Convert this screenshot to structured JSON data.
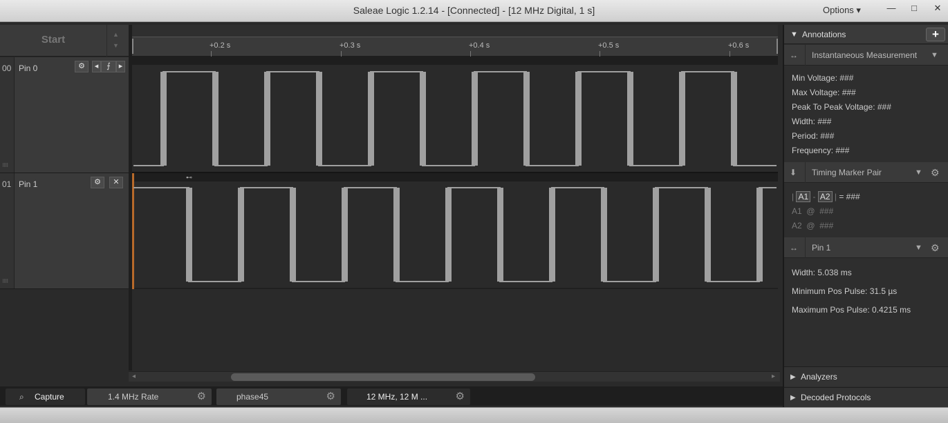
{
  "window": {
    "title": "Saleae Logic 1.2.14 - [Connected] - [12 MHz Digital, 1 s]",
    "options_label": "Options ▾",
    "minimize": "—",
    "maximize": "□",
    "close": "✕"
  },
  "controls": {
    "start_label": "Start"
  },
  "channels": [
    {
      "index": "00",
      "name": "Pin 0"
    },
    {
      "index": "01",
      "name": "Pin 1"
    }
  ],
  "ruler": {
    "ticks": [
      "+0.2 s",
      "+0.3 s",
      "+0.4 s",
      "+0.5 s",
      "+0.6 s"
    ]
  },
  "tabs": [
    {
      "label": "Capture",
      "icon": "search-icon"
    },
    {
      "label": "1.4 MHz Rate"
    },
    {
      "label": "phase45"
    },
    {
      "label": "12 MHz, 12 M ..."
    }
  ],
  "annotations": {
    "header": "Annotations",
    "instantaneous": {
      "title": "Instantaneous Measurement",
      "rows": [
        "Min Voltage: ###",
        "Max Voltage: ###",
        "Peak To Peak Voltage: ###",
        "Width: ###",
        "Period: ###",
        "Frequency: ###"
      ]
    },
    "timing_pair": {
      "title": "Timing Marker Pair",
      "a1": "A1",
      "a2": "A2",
      "value": "= ###",
      "a1_row_label": "A1",
      "a2_row_label": "A2",
      "at": "@",
      "a1_value": "###",
      "a2_value": "###"
    },
    "pin1": {
      "title": "Pin 1",
      "rows": [
        "Width: 5.038 ms",
        "Minimum Pos Pulse: 31.5 µs",
        "Maximum Pos Pulse: 0.4215 ms"
      ]
    }
  },
  "folds": {
    "analyzers": "Analyzers",
    "decoded": "Decoded Protocols"
  },
  "colors": {
    "trace": "#a0a0a0",
    "accent": "#b86a2a",
    "background": "#2a2a2a"
  }
}
